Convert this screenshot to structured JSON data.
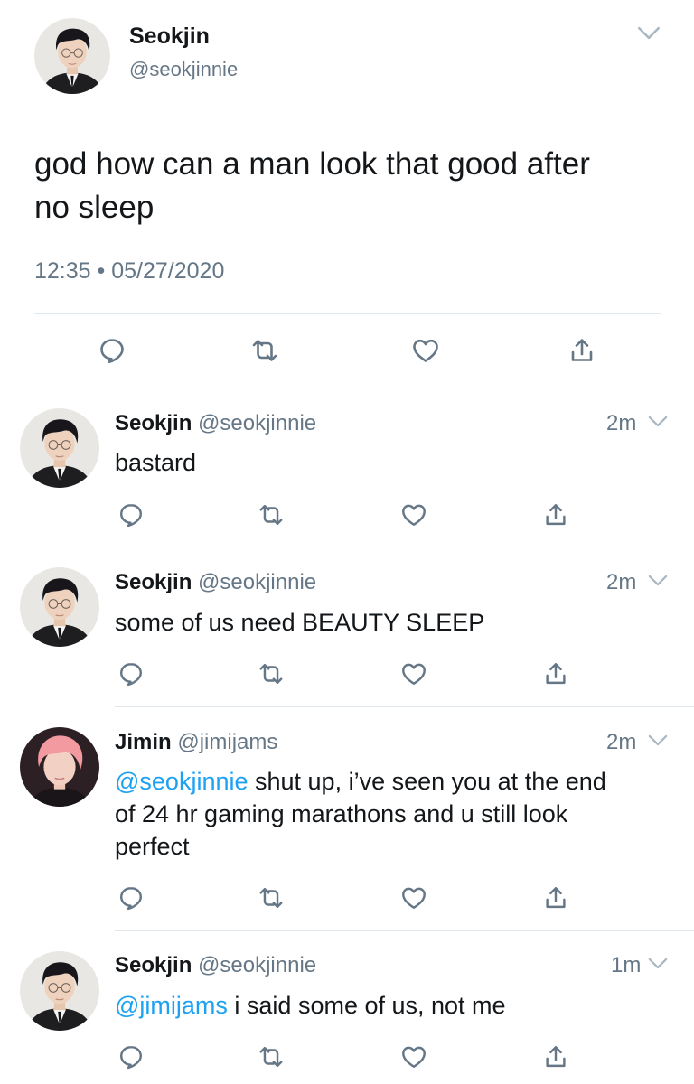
{
  "main_tweet": {
    "author_name": "Seokjin",
    "author_handle": "@seokjinnie",
    "text_line1": "god how can a man look that good after",
    "text_line2": "no sleep",
    "time": "12:35",
    "separator": "•",
    "date": "05/27/2020"
  },
  "replies": [
    {
      "name": "Seokjin",
      "handle": "@seokjinnie",
      "time": "2m",
      "mention": "",
      "text": "bastard"
    },
    {
      "name": "Seokjin",
      "handle": "@seokjinnie",
      "time": "2m",
      "mention": "",
      "text": "some of us need BEAUTY SLEEP"
    },
    {
      "name": "Jimin",
      "handle": "@jimijams",
      "time": "2m",
      "mention": "@seokjinnie",
      "text_line1": " shut up, i’ve seen you at the end",
      "text_line2": "of 24 hr gaming marathons and u still look",
      "text_line3": "perfect"
    },
    {
      "name": "Seokjin",
      "handle": "@seokjinnie",
      "time": "1m",
      "mention": "@jimijams",
      "text": " i said some of us, not me"
    }
  ],
  "icons": [
    "chevron-down-icon",
    "reply-icon",
    "retweet-icon",
    "like-icon",
    "share-icon"
  ],
  "colors": {
    "text": "#14171a",
    "secondary": "#657786",
    "mention": "#1da1f2",
    "divider": "#e1e8ed"
  }
}
